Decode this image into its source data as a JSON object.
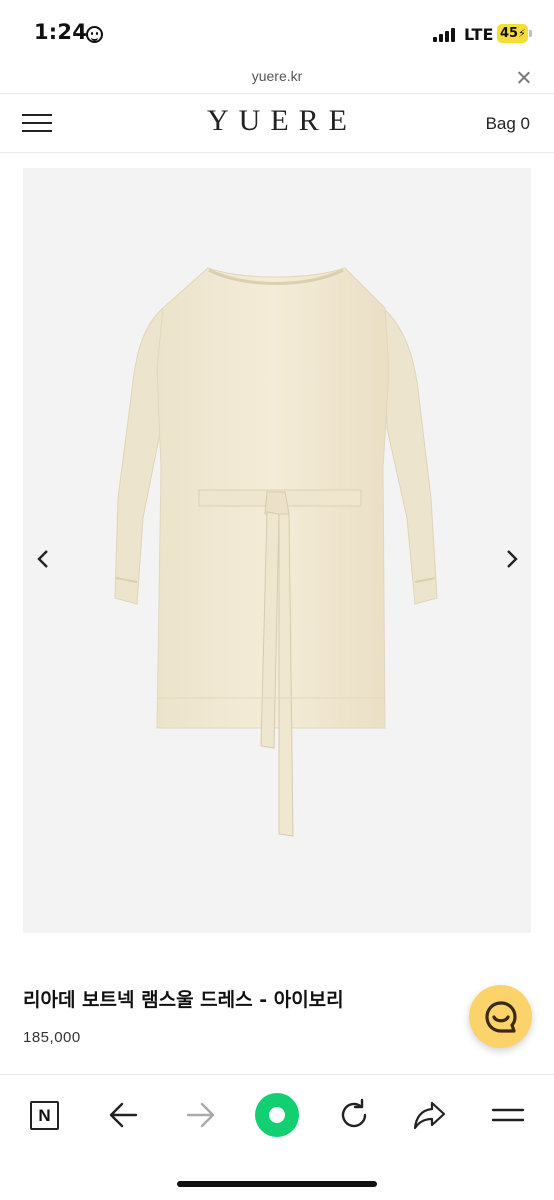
{
  "status_bar": {
    "time": "1:24",
    "network": "LTE",
    "battery": "45",
    "icons": [
      "smiley-face-icon",
      "signal-bars-icon",
      "battery-charging-icon"
    ]
  },
  "browser": {
    "url": "yuere.kr"
  },
  "header": {
    "logo": "YUERE",
    "bag_label": "Bag 0"
  },
  "product": {
    "image_alt_icon": "dress-image",
    "title": "리아데 보트넥 램스울 드레스 - 아이보리",
    "price": "185,000"
  },
  "colors": {
    "accent_green": "#12d072",
    "chat_yellow": "#fbd36a",
    "image_bg": "#f3f3f3",
    "dress": "#f2ead5"
  },
  "toolbar": {
    "icons": [
      "naver-n-icon",
      "back-arrow-icon",
      "forward-arrow-icon",
      "green-home-dot-icon",
      "reload-icon",
      "share-icon",
      "menu-lines-icon"
    ]
  }
}
